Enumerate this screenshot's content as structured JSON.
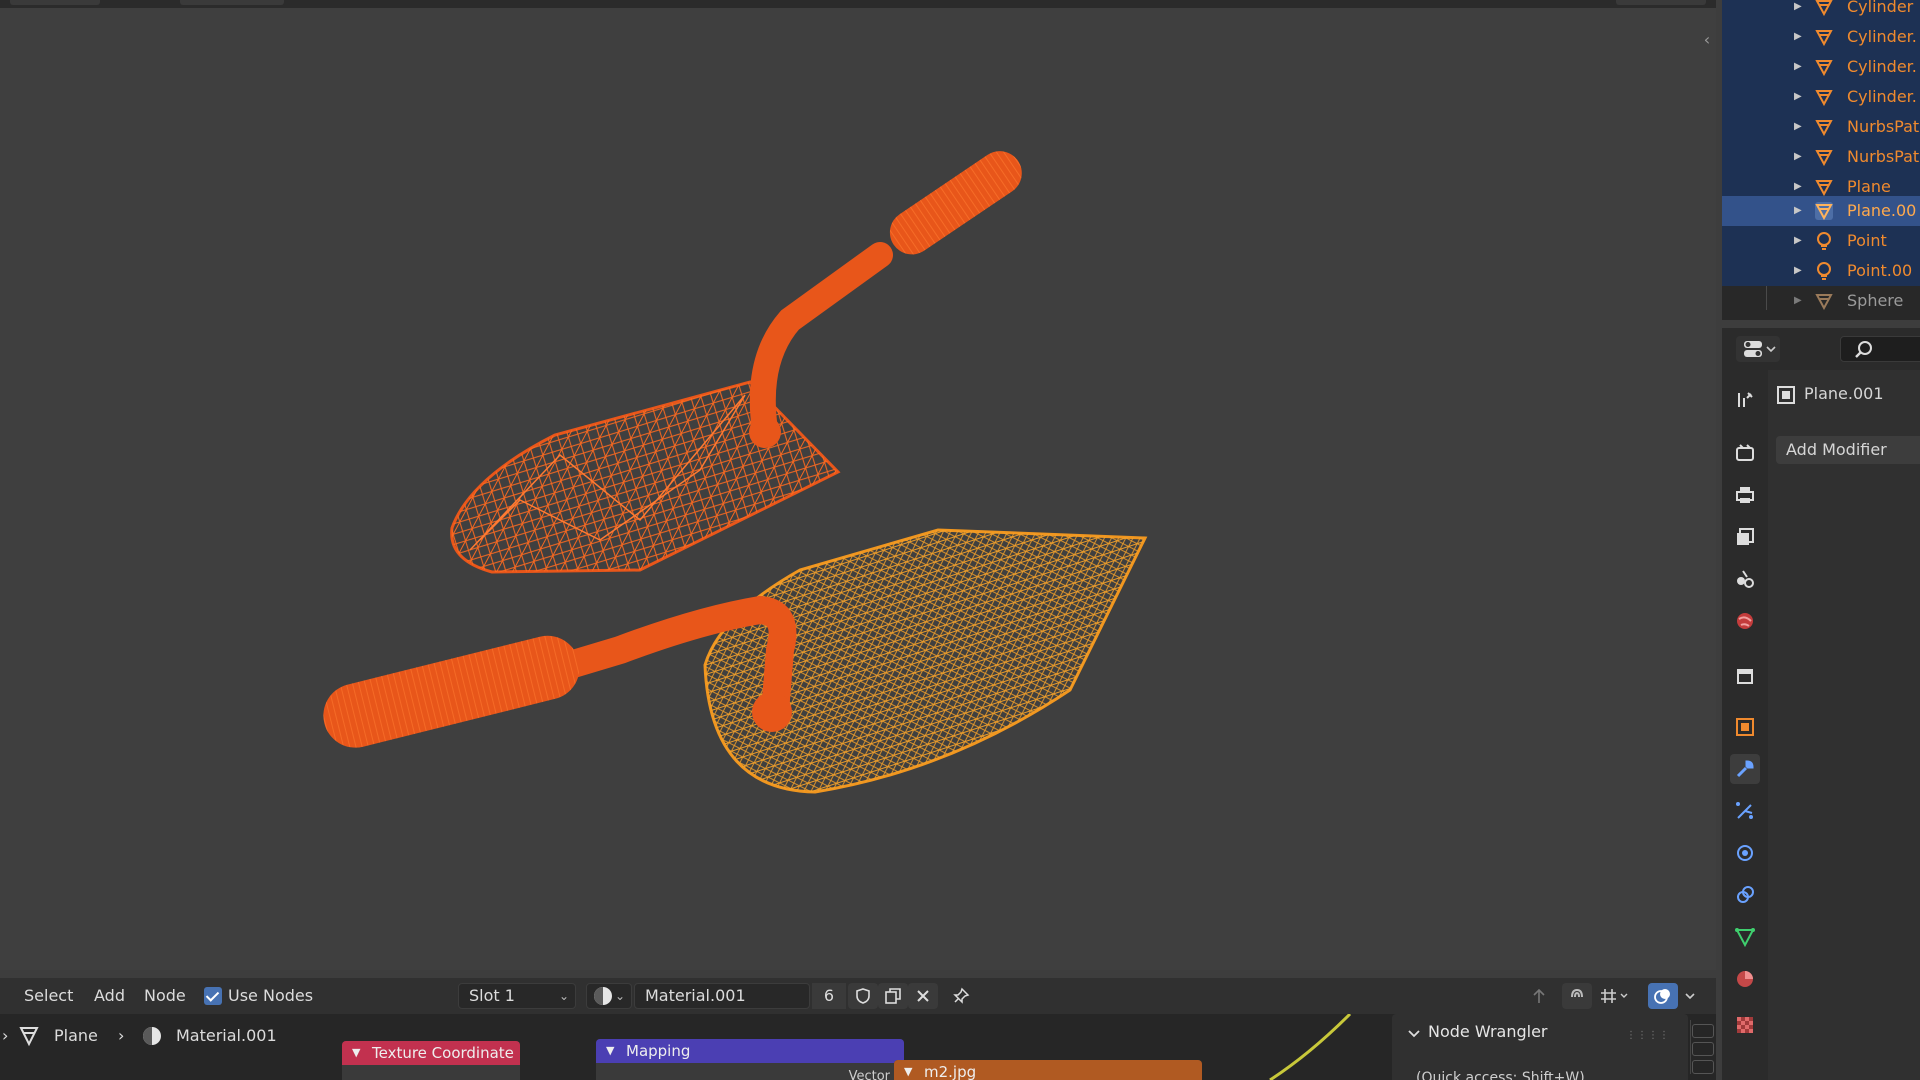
{
  "outliner": {
    "items": [
      {
        "label": "Cylinder",
        "icon": "mesh-icon",
        "state": "selected"
      },
      {
        "label": "Cylinder.",
        "icon": "mesh-icon",
        "state": "selected"
      },
      {
        "label": "Cylinder.",
        "icon": "mesh-icon",
        "state": "selected"
      },
      {
        "label": "Cylinder.",
        "icon": "mesh-icon",
        "state": "selected"
      },
      {
        "label": "NurbsPat",
        "icon": "mesh-icon",
        "state": "selected"
      },
      {
        "label": "NurbsPat",
        "icon": "mesh-icon",
        "state": "selected"
      },
      {
        "label": "Plane",
        "icon": "mesh-icon",
        "state": "selected"
      },
      {
        "label": "Plane.00",
        "icon": "mesh-icon",
        "state": "active"
      },
      {
        "label": "Point",
        "icon": "light-icon",
        "state": "selected"
      },
      {
        "label": "Point.00",
        "icon": "light-icon",
        "state": "selected"
      },
      {
        "label": "Sphere",
        "icon": "mesh-icon",
        "state": "normal"
      }
    ]
  },
  "properties": {
    "object_name": "Plane.001",
    "add_modifier_label": "Add Modifier",
    "active_tab": "modifier-tab"
  },
  "node_header": {
    "menu_select": "Select",
    "menu_add": "Add",
    "menu_node": "Node",
    "use_nodes_label": "Use Nodes",
    "use_nodes_checked": true,
    "slot": "Slot 1",
    "material_name": "Material.001",
    "user_count": "6"
  },
  "breadcrumb": {
    "object": "Plane",
    "material": "Material.001"
  },
  "nodes": {
    "texture_coordinate": "Texture Coordinate",
    "mapping": "Mapping",
    "image": "m2.jpg",
    "mapping_socket": "Vector"
  },
  "node_wrangler": {
    "title": "Node Wrangler",
    "hint": "(Quick access: Shift+W)"
  },
  "colors": {
    "selected_wire": "#e8561a",
    "active_wire": "#f0961f",
    "outliner_text": "#f08a2e",
    "texture_node": "#c2314f",
    "mapping_node": "#4b3fb3",
    "image_node": "#b05a22",
    "accent": "#4772b3"
  }
}
